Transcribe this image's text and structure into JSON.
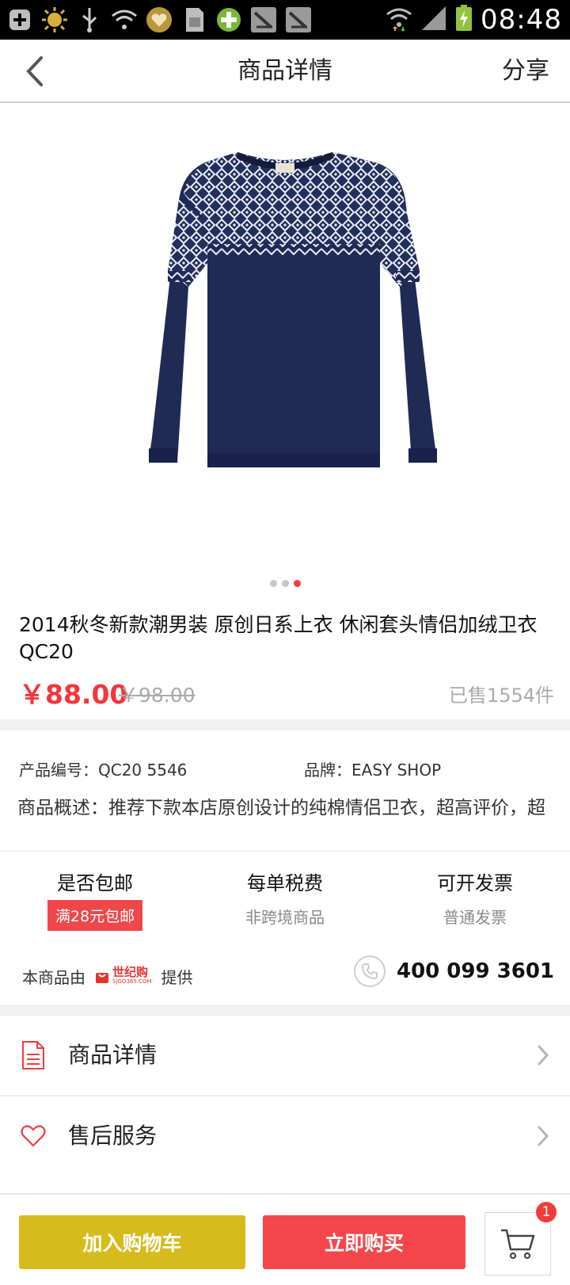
{
  "status_bar": {
    "time": "08:48",
    "icons": [
      "add-icon",
      "sun-icon",
      "usb-icon",
      "wifi-question-icon",
      "heart-icon",
      "sd-card-icon",
      "add-app-icon",
      "download-icon",
      "download-icon-2",
      "wifi-icon",
      "signal-icon",
      "battery-charging-icon"
    ]
  },
  "header": {
    "title": "商品详情",
    "share_label": "分享"
  },
  "carousel": {
    "total": 3,
    "active_index": 2
  },
  "product": {
    "title": "2014秋冬新款潮男装  原创日系上衣   休闲套头情侣加绒卫衣QC20",
    "price": "￥88.00",
    "old_price": "￥98.00",
    "sold": "已售1554件",
    "code": "产品编号：QC20 5546",
    "brand": "品牌：EASY SHOP",
    "summary": "商品概述：推荐下款本店原创设计的纯棉情侣卫衣，超高评价，超"
  },
  "features": [
    {
      "label": "是否包邮",
      "badge": "满28元包邮"
    },
    {
      "label": "每单税费",
      "sub": "非跨境商品"
    },
    {
      "label": "可开发票",
      "sub": "普通发票"
    }
  ],
  "provider": {
    "prefix": "本商品由",
    "logo_cn": "世纪购",
    "logo_en": "SJGO365.COM",
    "suffix": "提供",
    "phone": "400 099 3601"
  },
  "rows": [
    {
      "label": "商品详情"
    },
    {
      "label": "售后服务"
    }
  ],
  "bottom": {
    "add_cart": "加入购物车",
    "buy_now": "立即购买",
    "cart_count": "1"
  },
  "colors": {
    "accent_red": "#f5353b",
    "cart_yellow": "#d7bb1c",
    "buy_red": "#f5474b",
    "sweater_navy": "#1f2a55"
  }
}
